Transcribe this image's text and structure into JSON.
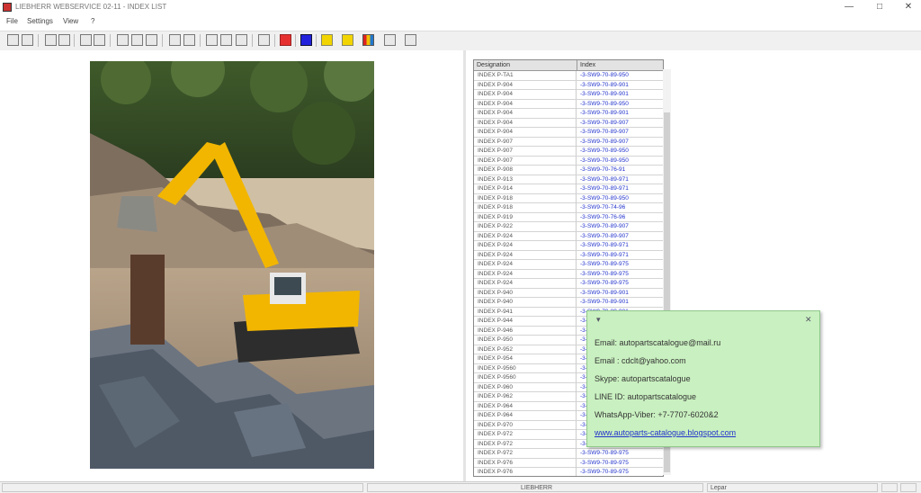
{
  "window": {
    "title": "LIEBHERR WEBSERVICE 02-11 - INDEX LIST",
    "minimize_glyph": "—",
    "maximize_glyph": "□",
    "close_glyph": "✕"
  },
  "menu": [
    "File",
    "Settings",
    "View",
    "?"
  ],
  "toolbar": {
    "buttons": [
      "first-icon",
      "prev-icon",
      "zoom-fit-icon",
      "zoom-width-icon",
      "print-icon",
      "save-icon",
      "zoom-in-icon",
      "zoom-out-icon",
      "page-icon",
      "find-icon",
      "find-next-icon",
      "copy-icon",
      "rotate-icon",
      "export-icon",
      "stop-icon",
      "blue-marker-icon",
      "info-icon",
      "edit-icon",
      "palette-icon",
      "help-icon",
      "keyboard-icon"
    ]
  },
  "table": {
    "columns": [
      "Designation",
      "Index"
    ],
    "rows": [
      {
        "designation": "INDEX P-TA1",
        "index": "-3-SW9-70-89-950"
      },
      {
        "designation": "INDEX P-904",
        "index": "-3-SW9-70-89-901"
      },
      {
        "designation": "INDEX P-904",
        "index": "-3-SW9-70-89-901"
      },
      {
        "designation": "INDEX P-904",
        "index": "-3-SW9-70-89-950"
      },
      {
        "designation": "INDEX P-904",
        "index": "-3-SW9-70-89-901"
      },
      {
        "designation": "INDEX P-904",
        "index": "-3-SW9-70-89-907"
      },
      {
        "designation": "INDEX P-904",
        "index": "-3-SW9-70-89-907"
      },
      {
        "designation": "INDEX P-907",
        "index": "-3-SW9-70-89-907"
      },
      {
        "designation": "INDEX P-907",
        "index": "-3-SW9-70-89-950"
      },
      {
        "designation": "INDEX P-907",
        "index": "-3-SW9-70-89-950"
      },
      {
        "designation": "INDEX P-908",
        "index": "-3-SW9-70-76-91"
      },
      {
        "designation": "INDEX P-913",
        "index": "-3-SW9-70-89-971"
      },
      {
        "designation": "INDEX P-914",
        "index": "-3-SW9-70-89-971"
      },
      {
        "designation": "INDEX P-918",
        "index": "-3-SW9-70-89-950"
      },
      {
        "designation": "INDEX P-918",
        "index": "-3-SW9-70-74-96"
      },
      {
        "designation": "INDEX P-919",
        "index": "-3-SW9-70-76-96"
      },
      {
        "designation": "INDEX P-922",
        "index": "-3-SW9-70-89-907"
      },
      {
        "designation": "INDEX P-924",
        "index": "-3-SW9-70-89-907"
      },
      {
        "designation": "INDEX P-924",
        "index": "-3-SW9-70-89-971"
      },
      {
        "designation": "INDEX P-924",
        "index": "-3-SW9-70-89-971"
      },
      {
        "designation": "INDEX P-924",
        "index": "-3-SW9-70-89-975"
      },
      {
        "designation": "INDEX P-924",
        "index": "-3-SW9-70-89-975"
      },
      {
        "designation": "INDEX P-924",
        "index": "-3-SW9-70-89-975"
      },
      {
        "designation": "INDEX P-940",
        "index": "-3-SW9-70-89-901"
      },
      {
        "designation": "INDEX P-940",
        "index": "-3-SW9-70-89-901"
      },
      {
        "designation": "INDEX P-941",
        "index": "-3-SW9-70-89-901"
      },
      {
        "designation": "INDEX P-944",
        "index": "-3-SW9-70-89-901"
      },
      {
        "designation": "INDEX P-946",
        "index": "-3-SW9-70-89-901"
      },
      {
        "designation": "INDEX P-950",
        "index": "-3-SW9-70-89-901"
      },
      {
        "designation": "INDEX P-952",
        "index": "-3-SW9-70-89-901"
      },
      {
        "designation": "INDEX P-954",
        "index": "-3-SW9-70-89-901"
      },
      {
        "designation": "INDEX P-9560",
        "index": "-3-SW9-70-89-901"
      },
      {
        "designation": "INDEX P-9560",
        "index": "-3-SW9-70-89-901"
      },
      {
        "designation": "INDEX P-960",
        "index": "-3-SW9-70-89-901"
      },
      {
        "designation": "INDEX P-962",
        "index": "-3-SW9-70-89-901"
      },
      {
        "designation": "INDEX P-964",
        "index": "-3-SW9-70-89-901"
      },
      {
        "designation": "INDEX P-964",
        "index": "-3-SW9-70-89-901"
      },
      {
        "designation": "INDEX P-970",
        "index": "-3-SW9-70-89-975"
      },
      {
        "designation": "INDEX P-972",
        "index": "-3-SW9-70-89-975"
      },
      {
        "designation": "INDEX P-972",
        "index": "-3-SW9-70-89-975"
      },
      {
        "designation": "INDEX P-972",
        "index": "-3-SW9-70-89-975"
      },
      {
        "designation": "INDEX P-976",
        "index": "-3-SW9-70-89-975"
      },
      {
        "designation": "INDEX P-976",
        "index": "-3-SW9-70-89-975"
      }
    ]
  },
  "popup": {
    "lines": [
      "Email: autopartscatalogue@mail.ru",
      "Email : cdclt@yahoo.com",
      "Skype: autopartscatalogue",
      "LINE ID: autopartscatalogue",
      "WhatsApp-Viber: +7-7707-6020&2"
    ],
    "link": "www.autoparts-catalogue.blogspot.com",
    "left_icon": "▾",
    "close_icon": "✕"
  },
  "status": {
    "center": "LIEBHERR",
    "right": "Lepar"
  },
  "colors": {
    "popup_bg": "#c9f0c0",
    "link": "#2233cc",
    "excavator": "#f2b600"
  }
}
